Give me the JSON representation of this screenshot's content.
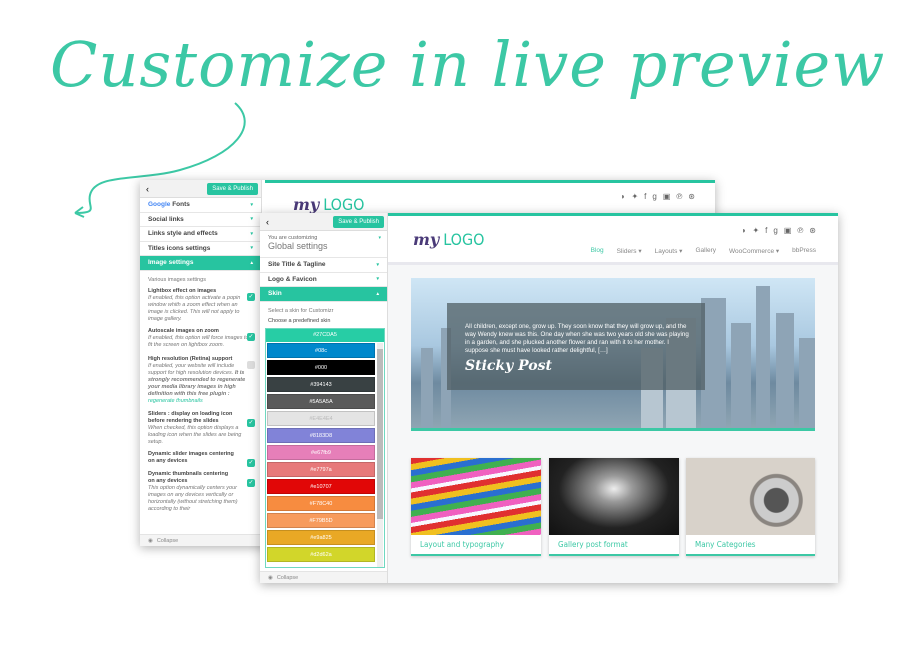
{
  "headline": "Customize in live preview",
  "back": {
    "publish": "Save & Publish",
    "sections": [
      {
        "label": "Fonts",
        "google": "Google"
      },
      {
        "label": "Social links"
      },
      {
        "label": "Links style and effects"
      },
      {
        "label": "Titles icons settings"
      },
      {
        "label": "Image settings",
        "active": true
      }
    ],
    "intro": "Various images settings",
    "options": [
      {
        "title": "Lightbox effect on images",
        "desc": "If enabled, this option activate a popin window whith a zoom effect when an image is clicked. This will not apply to image gallery.",
        "checked": true
      },
      {
        "title": "Autoscale images on zoom",
        "desc": "If enabled, this option will force images to fit the screen on lightbox zoom.",
        "checked": true
      },
      {
        "title": "High resolution (Retina) support",
        "desc": "If enabled, your website will include support for high resolution devices.",
        "desc_bold": "It is strongly recommended to regenerate your media library images in high definition with this free plugin :",
        "link": "regenerate thumbnails",
        "checked": false
      },
      {
        "title": "Sliders : display on loading icon before rendering the slides",
        "desc": "When checked, this option displays a loading icon when the slides are being setup.",
        "checked": true
      },
      {
        "title": "Dynamic slider images centering on any devices",
        "desc": "",
        "checked": true
      },
      {
        "title": "Dynamic thumbnails centering on any devices",
        "desc": "This option dynamically centers your images on any devices vertically or horizontally (without stretching them) according to their",
        "checked": true
      }
    ],
    "collapse": "Collapse",
    "logo_my": "my",
    "logo_text": "LOGO"
  },
  "front": {
    "publish": "Save & Publish",
    "customizing": "You are customizing",
    "global": "Global settings",
    "sections": [
      {
        "label": "Site Title & Tagline"
      },
      {
        "label": "Logo & Favicon"
      },
      {
        "label": "Skin",
        "active": true
      }
    ],
    "skin_intro": "Select a skin for Customizr",
    "skin_label": "Choose a predefined skin",
    "selected_skin": "#27CDA5",
    "skins": [
      {
        "label": "#08c",
        "color": "#0088cc"
      },
      {
        "label": "#000",
        "color": "#000000"
      },
      {
        "label": "#394143",
        "color": "#394143"
      },
      {
        "label": "#5A5A5A",
        "color": "#5a5a5a"
      },
      {
        "label": "#E4E4E4",
        "color": "#e4e4e4"
      },
      {
        "label": "#8183D8",
        "color": "#8183d8"
      },
      {
        "label": "#e67fb9",
        "color": "#e67fb9"
      },
      {
        "label": "#e7797a",
        "color": "#e7797a"
      },
      {
        "label": "#e10707",
        "color": "#e10707"
      },
      {
        "label": "#F78C40",
        "color": "#f78c40"
      },
      {
        "label": "#F79B5D",
        "color": "#f79b5d"
      },
      {
        "label": "#e9a825",
        "color": "#e9a825"
      },
      {
        "label": "#d2d62a",
        "color": "#d2d62a"
      }
    ],
    "collapse": "Collapse",
    "logo_my": "my",
    "logo_text": "LOGO",
    "nav": [
      "Blog",
      "Sliders ▾",
      "Layouts ▾",
      "Gallery",
      "WooCommerce ▾",
      "bbPress"
    ],
    "hero_text": "All children, except one, grow up. They soon know that they will grow up, and the way Wendy knew was this. One day when she was two years old she was playing in a garden, and she plucked another flower and ran with it to her mother. I suppose she must have looked rather delightful, […]",
    "hero_title": "Sticky Post",
    "cards": [
      "Layout and typography",
      "Gallery post format",
      "Many Categories"
    ]
  },
  "social_icons": [
    "rss-icon",
    "twitter-icon",
    "facebook-icon",
    "google-plus-icon",
    "instagram-icon",
    "pinterest-icon",
    "dribbble-icon"
  ],
  "accent": "#27c4a0"
}
